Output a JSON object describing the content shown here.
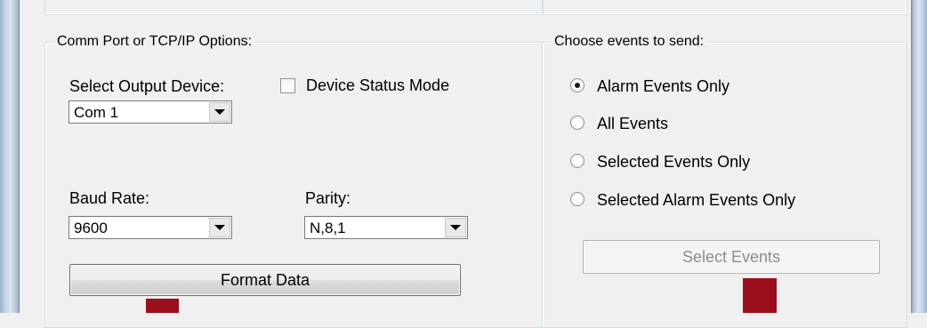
{
  "comm_group": {
    "legend": "Comm Port or TCP/IP Options:",
    "output_device_label": "Select Output Device:",
    "output_device_value": "Com 1",
    "device_status_mode_label": "Device Status Mode",
    "baud_rate_label": "Baud Rate:",
    "baud_rate_value": "9600",
    "parity_label": "Parity:",
    "parity_value": "N,8,1",
    "format_data_button": "Format Data"
  },
  "events_group": {
    "legend": "Choose events to send:",
    "options": [
      {
        "label": "Alarm Events Only",
        "checked": true
      },
      {
        "label": "All Events",
        "checked": false
      },
      {
        "label": "Selected Events Only",
        "checked": false
      },
      {
        "label": "Selected Alarm Events Only",
        "checked": false
      }
    ],
    "select_events_button": "Select Events"
  },
  "colors": {
    "marker": "#9b0f1d",
    "background": "#f0f0f0"
  }
}
